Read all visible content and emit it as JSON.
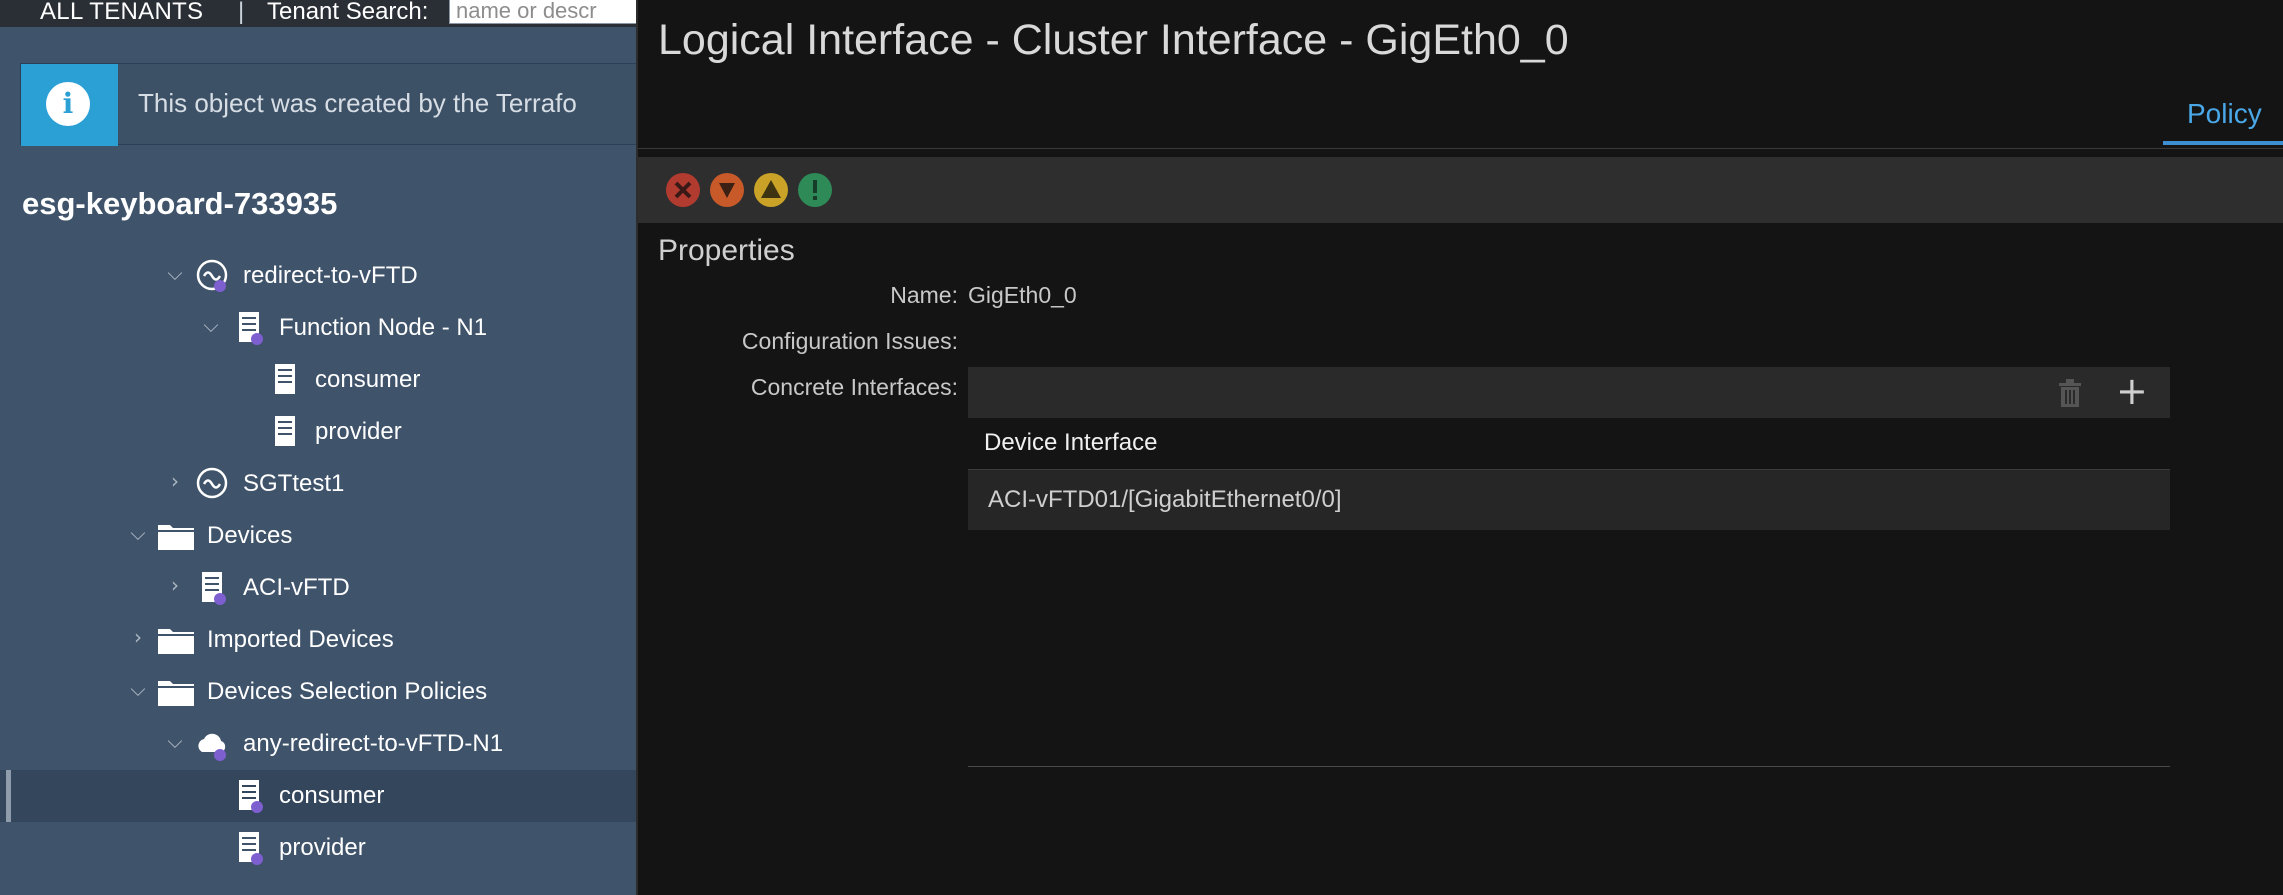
{
  "topbar": {
    "all_tenants": "ALL TENANTS",
    "divider": "|",
    "search_label": "Tenant Search:",
    "search_placeholder": "name or descr"
  },
  "info_banner": {
    "icon": "info-icon",
    "message": "This object was created by the Terrafo"
  },
  "tenant_title": "esg-keyboard-733935",
  "tree": [
    {
      "label": "redirect-to-vFTD",
      "icon": "service-graph-icon",
      "chevron": "expanded"
    },
    {
      "label": "Function Node - N1",
      "icon": "node-document-icon",
      "chevron": "expanded"
    },
    {
      "label": "consumer",
      "icon": "document-icon",
      "chevron": "none"
    },
    {
      "label": "provider",
      "icon": "document-icon",
      "chevron": "none"
    },
    {
      "label": "SGTtest1",
      "icon": "service-graph-icon",
      "chevron": "collapsed"
    },
    {
      "label": "Devices",
      "icon": "folder-icon",
      "chevron": "expanded"
    },
    {
      "label": "ACI-vFTD",
      "icon": "node-document-icon",
      "chevron": "collapsed"
    },
    {
      "label": "Imported Devices",
      "icon": "folder-icon",
      "chevron": "collapsed"
    },
    {
      "label": "Devices Selection Policies",
      "icon": "folder-icon",
      "chevron": "expanded"
    },
    {
      "label": "any-redirect-to-vFTD-N1",
      "icon": "cloud-icon",
      "chevron": "expanded"
    },
    {
      "label": "consumer",
      "icon": "node-document-icon",
      "chevron": "none",
      "selected": true
    },
    {
      "label": "provider",
      "icon": "node-document-icon",
      "chevron": "none"
    }
  ],
  "dialog": {
    "title": "Logical Interface - Cluster Interface - GigEth0_0",
    "tabs": [
      {
        "label": "Policy",
        "active": true
      }
    ],
    "fault_icons": [
      {
        "name": "critical-fault-icon",
        "color": "#b23b2f"
      },
      {
        "name": "major-fault-icon",
        "color": "#c85a2a"
      },
      {
        "name": "minor-fault-icon",
        "color": "#c9a227"
      },
      {
        "name": "warning-fault-icon",
        "color": "#2e8b57"
      }
    ],
    "properties_heading": "Properties",
    "properties": {
      "name_label": "Name:",
      "name_value": "GigEth0_0",
      "config_issues_label": "Configuration Issues:",
      "concrete_interfaces_label": "Concrete Interfaces:"
    },
    "concrete_interfaces_table": {
      "toolbar_icons": [
        "trash-icon",
        "plus-icon"
      ],
      "columns": [
        "Device Interface"
      ],
      "rows": [
        [
          "ACI-vFTD01/[GigabitEthernet0/0]"
        ]
      ]
    }
  },
  "colors": {
    "left_pane_bg": "#3f536b",
    "dialog_bg": "#141414",
    "accent_blue": "#3d8fd1",
    "info_blue": "#2aa0d4"
  }
}
